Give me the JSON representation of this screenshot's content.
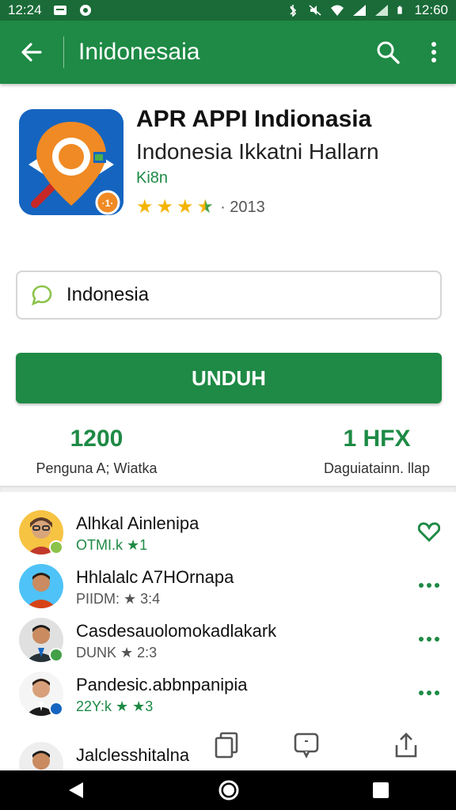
{
  "status_bar": {
    "time_left": "12:24",
    "time_right": "12:60"
  },
  "app_bar": {
    "title": "Inidonesaia"
  },
  "app": {
    "name": "APR APPI Indionasia",
    "developer": "Indonesia Ikkatni Hallarn",
    "category": "Ki8n",
    "rating_stars": 3.5,
    "rating_count": "2013",
    "colors": {
      "icon_bg": "#1565c0",
      "icon_main": "#f08a24",
      "brand": "#1e8a45"
    }
  },
  "search": {
    "value": "Indonesia",
    "icon": "chat-bubble-icon"
  },
  "install_button": {
    "label": "UNDUH"
  },
  "stats": [
    {
      "value": "1200",
      "label": "Penguna A; Wiatka"
    },
    {
      "value": "1 HFX",
      "label": "Daguiatainn. llap"
    }
  ],
  "list": [
    {
      "title": "Alhkal Ainlenipa",
      "subtitle": "OTMI.k ★1",
      "subtitle_green": true,
      "action": "heart-icon"
    },
    {
      "title": "Hhlalalc A7HOrnapa",
      "subtitle": "PIIDM: ★ 3:4",
      "subtitle_green": false,
      "action": "more-icon"
    },
    {
      "title": "Casdesauolomokadlakark",
      "subtitle": "DUNK ★ 2:3",
      "subtitle_green": false,
      "action": "more-icon"
    },
    {
      "title": "Pandesic.abbnpanipia",
      "subtitle": "22Y:k ★ ★3",
      "subtitle_green": true,
      "action": "more-icon"
    },
    {
      "title": "Jalclesshitalna",
      "subtitle": "",
      "subtitle_green": false,
      "action": ""
    }
  ],
  "toolbar": {
    "icons": [
      "copy-icon",
      "comment-icon",
      "share-icon"
    ]
  },
  "nav": {
    "icons": [
      "back-triangle-icon",
      "home-circle-icon",
      "recents-square-icon"
    ]
  }
}
